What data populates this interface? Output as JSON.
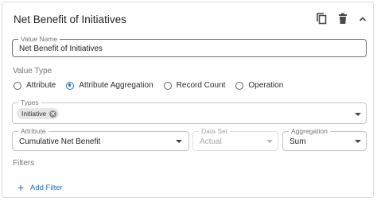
{
  "header": {
    "title": "Net Benefit of Initiatives",
    "icons": [
      "copy-icon",
      "trash-icon",
      "chevron-up-icon"
    ]
  },
  "value_name": {
    "label": "Value Name",
    "value": "Net Benefit of Initiatives"
  },
  "value_type": {
    "label": "Value Type",
    "options": [
      {
        "label": "Attribute",
        "checked": false
      },
      {
        "label": "Attribute Aggregation",
        "checked": true
      },
      {
        "label": "Record Count",
        "checked": false
      },
      {
        "label": "Operation",
        "checked": false
      }
    ]
  },
  "types": {
    "label": "Types",
    "chips": [
      "Initiative"
    ]
  },
  "attribute": {
    "label": "Attribute",
    "value": "Cumulative Net Benefit"
  },
  "data_set": {
    "label": "Data Set",
    "value": "Actual",
    "disabled": true
  },
  "aggregation": {
    "label": "Aggregation",
    "value": "Sum"
  },
  "filters": {
    "label": "Filters",
    "add_label": "Add Filter"
  },
  "colors": {
    "accent": "#1f6fb2",
    "border": "#c4c4c4",
    "muted_text": "#777777"
  }
}
